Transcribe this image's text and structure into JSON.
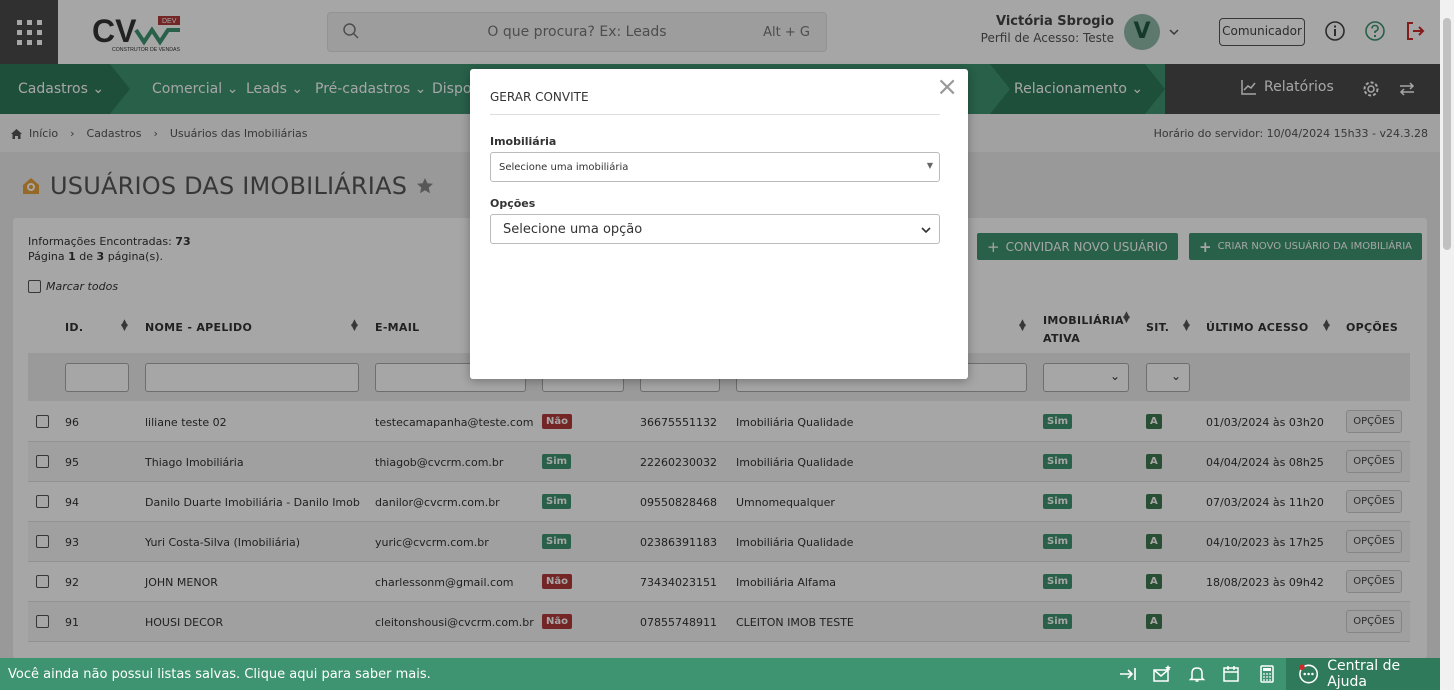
{
  "search": {
    "placeholder": "O que procura? Ex: Leads",
    "shortcut": "Alt + G"
  },
  "user": {
    "name": "Victória Sbrogio",
    "profile": "Perfil de Acesso: Teste",
    "initial": "V"
  },
  "header": {
    "communicator_label": "Comunicador"
  },
  "logo": {
    "text": "CV",
    "badge": "DEV",
    "tagline": "CONSTRUTOR DE VENDAS"
  },
  "nav": {
    "items": [
      "Cadastros",
      "Comercial",
      "Leads",
      "Pré-cadastros",
      "Dispo",
      "Relacionamento"
    ],
    "reports": "Relatórios"
  },
  "breadcrumb": {
    "items": [
      "Início",
      "Cadastros",
      "Usuários das Imobiliárias"
    ],
    "server_time": "Horário do servidor: 10/04/2024 15h33 - v24.3.28"
  },
  "page": {
    "title": "USUÁRIOS DAS IMOBILIÁRIAS"
  },
  "summary": {
    "found_label": "Informações Encontradas:",
    "found": "73",
    "page_prefix": "Página",
    "page": "1",
    "of": "de",
    "total_pages": "3",
    "suffix": "página(s)."
  },
  "mark_all": "Marcar todos",
  "buttons": {
    "invite": "CONVIDAR NOVO USUÁRIO",
    "create": "CRIAR NOVO USUÁRIO DA IMOBILIÁRIA"
  },
  "table": {
    "headers": {
      "id": "ID.",
      "name": "NOME - APELIDO",
      "email": "E-MAIL",
      "active_1": "IMOBILIÁRIA",
      "active_2": "ATIVA",
      "sit": "SIT.",
      "last": "ÚLTIMO ACESSO",
      "options": "OPÇÕES"
    },
    "rows": [
      {
        "id": "96",
        "name": "liliane teste 02",
        "email": "testecamapanha@teste.com",
        "status": "Não",
        "phone": "36675551132",
        "agency": "Imobiliária Qualidade",
        "active": "Sim",
        "sit": "A",
        "last": "01/03/2024 às 03h20",
        "opt": "OPÇÕES"
      },
      {
        "id": "95",
        "name": "Thiago Imobiliária",
        "email": "thiagob@cvcrm.com.br",
        "status": "Sim",
        "phone": "22260230032",
        "agency": "Imobiliária Qualidade",
        "active": "Sim",
        "sit": "A",
        "last": "04/04/2024 às 08h25",
        "opt": "OPÇÕES"
      },
      {
        "id": "94",
        "name": "Danilo Duarte Imobiliária - Danilo Imob",
        "email": "danilor@cvcrm.com.br",
        "status": "Sim",
        "phone": "09550828468",
        "agency": "Umnomequalquer",
        "active": "Sim",
        "sit": "A",
        "last": "07/03/2024 às 11h20",
        "opt": "OPÇÕES"
      },
      {
        "id": "93",
        "name": "Yuri Costa-Silva (Imobiliária)",
        "email": "yuric@cvcrm.com.br",
        "status": "Sim",
        "phone": "02386391183",
        "agency": "Imobiliária Qualidade",
        "active": "Sim",
        "sit": "A",
        "last": "04/10/2023 às 17h25",
        "opt": "OPÇÕES"
      },
      {
        "id": "92",
        "name": "JOHN MENOR",
        "email": "charlessonm@gmail.com",
        "status": "Não",
        "phone": "73434023151",
        "agency": "Imobiliária Alfama",
        "active": "Sim",
        "sit": "A",
        "last": "18/08/2023 às 09h42",
        "opt": "OPÇÕES"
      },
      {
        "id": "91",
        "name": "HOUSI DECOR",
        "email": "cleitonshousi@cvcrm.com.br",
        "status": "Não",
        "phone": "07855748911",
        "agency": "CLEITON IMOB TESTE",
        "active": "Sim",
        "sit": "A",
        "last": "",
        "opt": "OPÇÕES"
      }
    ]
  },
  "modal": {
    "title": "GERAR CONVITE",
    "close": "×",
    "agency_label": "Imobiliária",
    "agency_placeholder": "Selecione uma imobiliária",
    "options_label": "Opções",
    "options_placeholder": "Selecione uma opção"
  },
  "bottom": {
    "message": "Você ainda não possui listas salvas. Clique aqui para saber mais.",
    "help": "Central de Ajuda"
  },
  "colors": {
    "primary": "#3e9470",
    "dark_green": "#2f7a5b",
    "danger": "#b33a3a",
    "gray": "#4a4a4a"
  }
}
